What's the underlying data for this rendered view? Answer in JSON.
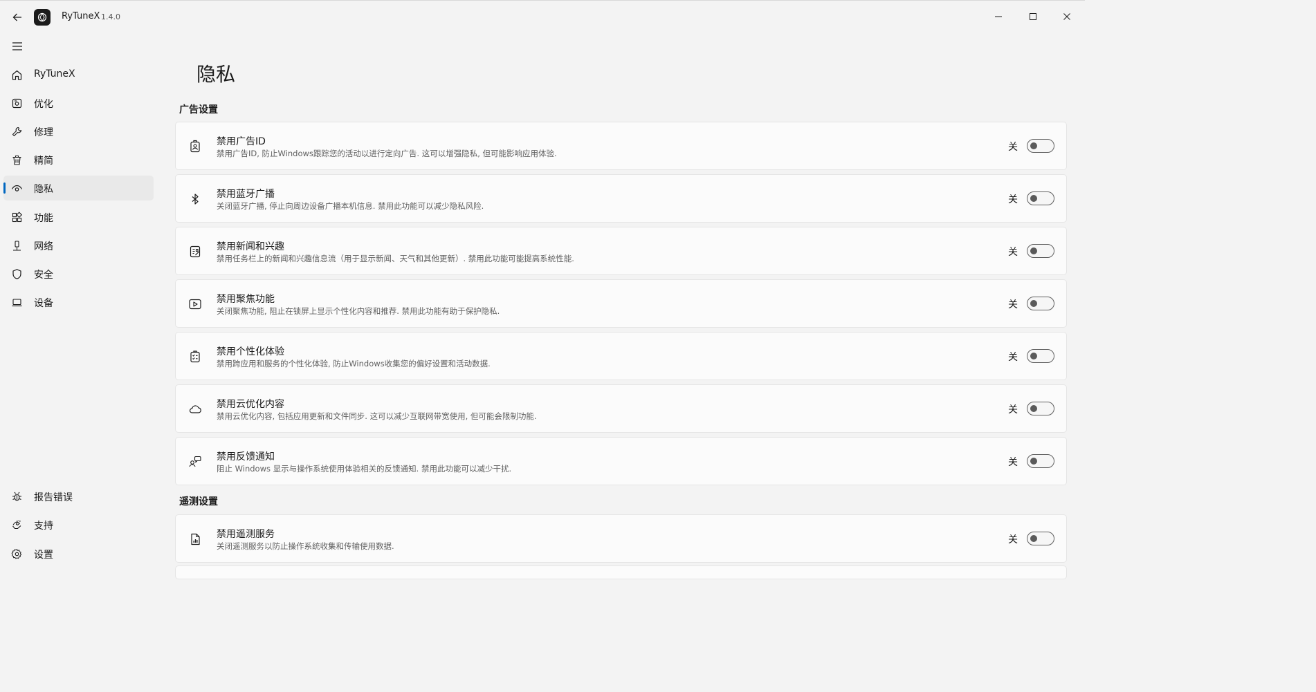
{
  "app": {
    "name": "RyTuneX",
    "version": "1.4.0"
  },
  "nav": {
    "items": [
      {
        "label": "RyTuneX",
        "icon": "home-icon"
      },
      {
        "label": "优化",
        "icon": "optimize-icon"
      },
      {
        "label": "修理",
        "icon": "wrench-icon"
      },
      {
        "label": "精简",
        "icon": "trash-icon"
      },
      {
        "label": "隐私",
        "icon": "eye-icon",
        "active": true
      },
      {
        "label": "功能",
        "icon": "apps-icon"
      },
      {
        "label": "网络",
        "icon": "network-icon"
      },
      {
        "label": "安全",
        "icon": "shield-icon"
      },
      {
        "label": "设备",
        "icon": "laptop-icon"
      }
    ],
    "footer": [
      {
        "label": "报告错误",
        "icon": "bug-icon"
      },
      {
        "label": "支持",
        "icon": "support-icon"
      },
      {
        "label": "设置",
        "icon": "gear-icon"
      }
    ]
  },
  "page": {
    "title": "隐私"
  },
  "sections": [
    {
      "title": "广告设置",
      "items": [
        {
          "title": "禁用广告ID",
          "desc": "禁用广告ID, 防止Windows跟踪您的活动以进行定向广告. 这可以增强隐私, 但可能影响应用体验.",
          "state": "关",
          "on": false,
          "icon": "id-badge-icon"
        },
        {
          "title": "禁用蓝牙广播",
          "desc": "关闭蓝牙广播, 停止向周边设备广播本机信息. 禁用此功能可以减少隐私风险.",
          "state": "关",
          "on": false,
          "icon": "bluetooth-icon"
        },
        {
          "title": "禁用新闻和兴趣",
          "desc": "禁用任务栏上的新闻和兴趣信息流（用于显示新闻、天气和其他更新）. 禁用此功能可能提高系统性能.",
          "state": "关",
          "on": false,
          "icon": "news-icon"
        },
        {
          "title": "禁用聚焦功能",
          "desc": "关闭聚焦功能, 阻止在锁屏上显示个性化内容和推荐. 禁用此功能有助于保护隐私.",
          "state": "关",
          "on": false,
          "icon": "play-icon"
        },
        {
          "title": "禁用个性化体验",
          "desc": "禁用跨应用和服务的个性化体验, 防止Windows收集您的偏好设置和活动数据.",
          "state": "关",
          "on": false,
          "icon": "clipboard-icon"
        },
        {
          "title": "禁用云优化内容",
          "desc": "禁用云优化内容, 包括应用更新和文件同步. 这可以减少互联网带宽使用, 但可能会限制功能.",
          "state": "关",
          "on": false,
          "icon": "cloud-icon"
        },
        {
          "title": "禁用反馈通知",
          "desc": "阻止 Windows 显示与操作系统使用体验相关的反馈通知. 禁用此功能可以减少干扰.",
          "state": "关",
          "on": false,
          "icon": "feedback-icon"
        }
      ]
    },
    {
      "title": "遥测设置",
      "items": [
        {
          "title": "禁用遥测服务",
          "desc": "关闭遥测服务以防止操作系统收集和传输使用数据.",
          "state": "关",
          "on": false,
          "icon": "report-icon"
        }
      ]
    }
  ]
}
